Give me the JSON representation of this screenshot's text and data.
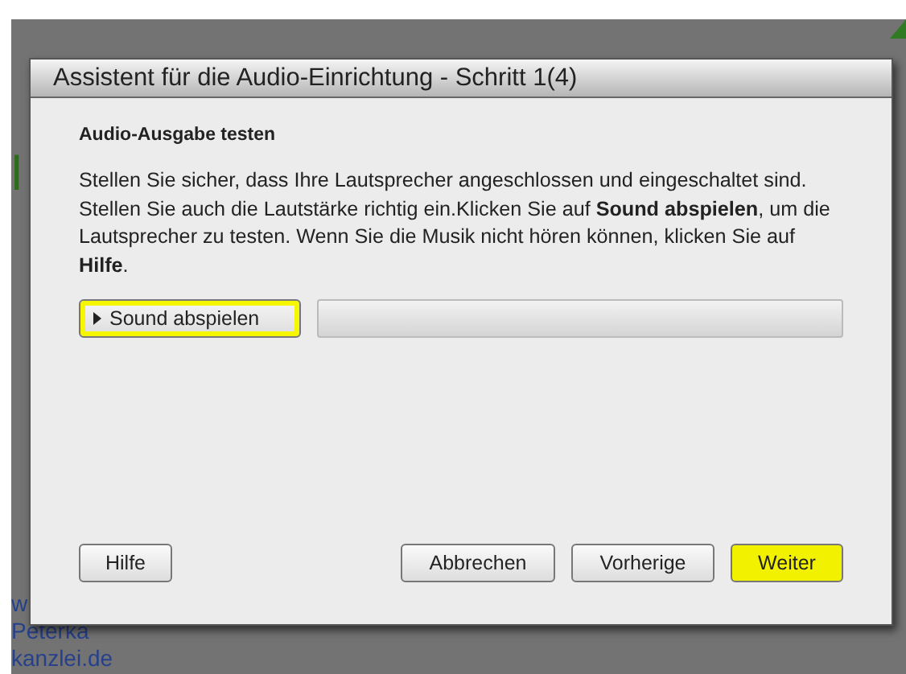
{
  "background": {
    "letter": "l",
    "lines": [
      "w",
      "Peterka",
      "kanzlei.de"
    ]
  },
  "dialog": {
    "title": "Assistent für die Audio-Einrichtung - Schritt 1(4)",
    "heading": "Audio-Ausgabe testen",
    "instructions": "Stellen Sie sicher, dass Ihre Lautsprecher angeschlossen und eingeschaltet sind. Stellen Sie auch die Lautstärke richtig ein.Klicken Sie auf **Sound abspielen**, um die Lautsprecher zu testen. Wenn Sie die Musik nicht hören können, klicken Sie auf **Hilfe**.",
    "play_button": {
      "label": "Sound abspielen",
      "highlighted": true
    },
    "progress": {
      "level": 0
    },
    "buttons": [
      {
        "label": "Hilfe",
        "highlighted": false
      },
      {
        "label": "Abbrechen",
        "highlighted": false
      },
      {
        "label": "Vorherige",
        "highlighted": false
      },
      {
        "label": "Weiter",
        "highlighted": true
      }
    ]
  }
}
